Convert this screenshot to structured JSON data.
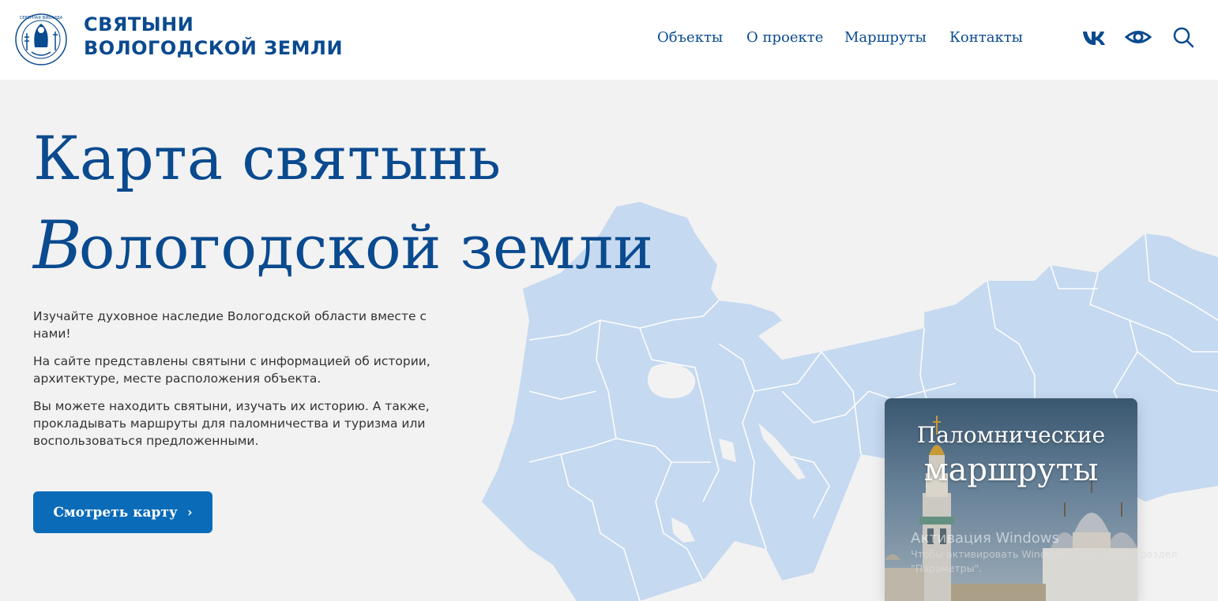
{
  "header": {
    "logo_circle_text": "СЕВЕРНАЯ ФИВАИДА",
    "logo_line1": "СВЯТЫНИ",
    "logo_line2": "ВОЛОГОДСКОЙ ЗЕМЛИ",
    "nav": [
      {
        "label": "Объекты"
      },
      {
        "label": "О проекте"
      },
      {
        "label": "Маршруты"
      },
      {
        "label": "Контакты"
      }
    ],
    "icons": [
      "vk-icon",
      "eye-icon",
      "search-icon"
    ]
  },
  "hero": {
    "title_line1": "Карта святынь",
    "title_cap": "В",
    "title_line2_rest": "ологодской земли",
    "paragraphs": [
      "Изучайте духовное наследие Вологодской области вместе с нами!",
      "На сайте представлены святыни с информацией об истории, архитектуре, месте расположения объекта.",
      "Вы можете находить святыни, изучать их историю. А также, прокладывать маршруты для паломничества и туризма или воспользоваться предложенными."
    ],
    "button_label": "Смотреть карту",
    "button_chevron": "›"
  },
  "card": {
    "title_line1": "Паломнические",
    "title_line2": "маршруты"
  },
  "watermark": {
    "line1": "Активация Windows",
    "line2": "Чтобы активировать Windows, перейдите в раздел",
    "line3": "\"Параметры\"."
  },
  "colors": {
    "brand_blue": "#0a4a8f",
    "button_blue": "#0a6bb8",
    "map_fill": "#c5d9f0",
    "background": "#f2f2f2"
  }
}
